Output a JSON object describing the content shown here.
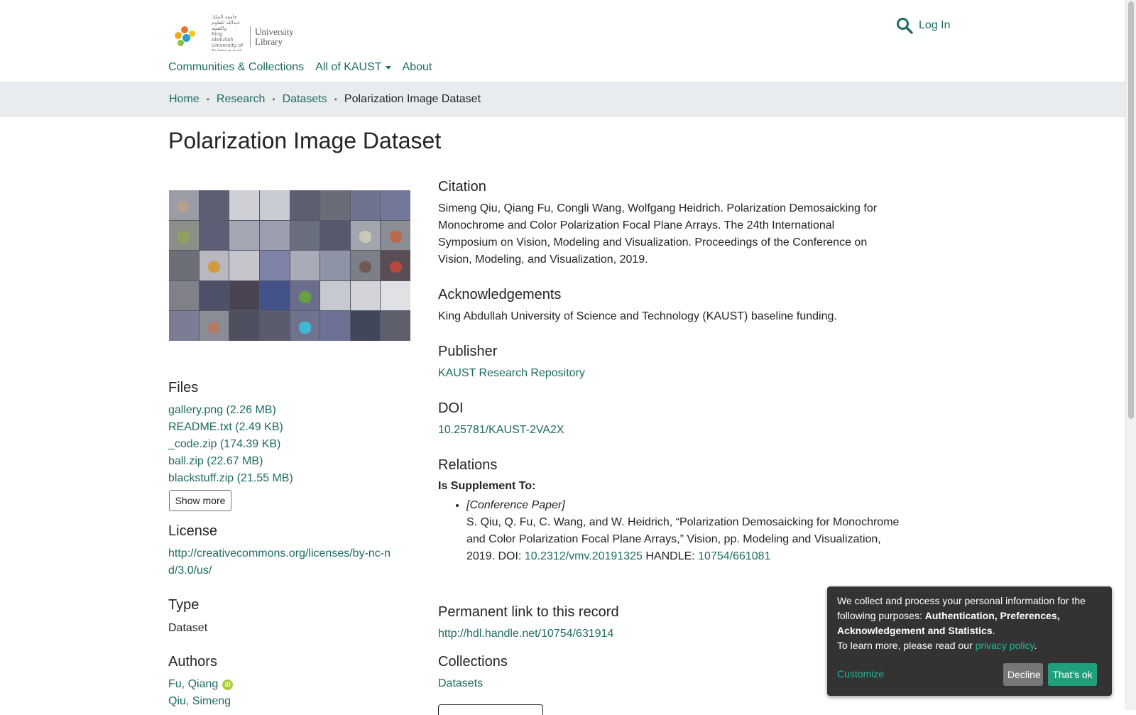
{
  "colors": {
    "link": "#1d6b62",
    "breadcrumb_bg": "#e9ecef",
    "cookie_bg": "#333333",
    "accept": "#1f9f7c",
    "decline": "#777777"
  },
  "header": {
    "logo_arabic": "جامعة الملك عبدالله للعلوم والتقنية",
    "logo_english": "King Abdullah University of Science and Technology",
    "logo_line1": "University",
    "logo_line2": "Library",
    "search_icon": "search-icon",
    "login": "Log In"
  },
  "nav": {
    "items": [
      "Communities & Collections",
      "All of KAUST",
      "About"
    ]
  },
  "breadcrumb": {
    "items": [
      "Home",
      "Research",
      "Datasets"
    ],
    "current": "Polarization Image Dataset"
  },
  "page": {
    "title": "Polarization Image Dataset"
  },
  "files": {
    "heading": "Files",
    "items": [
      "gallery.png (2.26 MB)",
      "README.txt (2.49 KB)",
      "_code.zip (174.39 KB)",
      "ball.zip (22.67 MB)",
      "blackstuff.zip (21.55 MB)"
    ],
    "show_more": "Show more"
  },
  "license": {
    "heading": "License",
    "url": "http://creativecommons.org/licenses/by-nc-nd/3.0/us/"
  },
  "type": {
    "heading": "Type",
    "value": "Dataset"
  },
  "authors": {
    "heading": "Authors",
    "items": [
      "Fu, Qiang",
      "Qiu, Simeng"
    ],
    "orcid_badge": "iD"
  },
  "citation": {
    "heading": "Citation",
    "text": "Simeng Qiu, Qiang Fu, Congli Wang, Wolfgang Heidrich. Polarization Demosaicking for Monochrome and Color Polarization Focal Plane Arrays. The 24th International Symposium on Vision, Modeling and Visualization. Proceedings of the Conference on Vision, Modeling, and Visualization, 2019."
  },
  "acknowledgements": {
    "heading": "Acknowledgements",
    "text": "King Abdullah University of Science and Technology (KAUST) baseline funding."
  },
  "publisher": {
    "heading": "Publisher",
    "value": "KAUST Research Repository"
  },
  "doi": {
    "heading": "DOI",
    "value": "10.25781/KAUST-2VA2X"
  },
  "relations": {
    "heading": "Relations",
    "label": "Is Supplement To:",
    "type": "[Conference Paper]",
    "text": "S. Qiu, Q. Fu, C. Wang, and W. Heidrich, “Polarization Demosaicking for Monochrome and Color Polarization Focal Plane Arrays,” Vision, pp. Modeling and Visualization, 2019. DOI: ",
    "doi_link": "10.2312/vmv.20191325",
    "handle_label": " HANDLE: ",
    "handle_link": "10754/661081"
  },
  "permalink": {
    "heading": "Permanent link to this record",
    "url": "http://hdl.handle.net/10754/631914"
  },
  "collections": {
    "heading": "Collections",
    "items": [
      "Datasets"
    ]
  },
  "cookie": {
    "text_start": "We collect and process your personal information for the following purposes: ",
    "purposes": "Authentication, Preferences, Acknowledgement and Statistics",
    "period": ".",
    "learn_more": "To learn more, please read our ",
    "privacy_link": "privacy policy",
    "customize": "Customize",
    "decline": "Decline",
    "accept": "That's ok"
  }
}
